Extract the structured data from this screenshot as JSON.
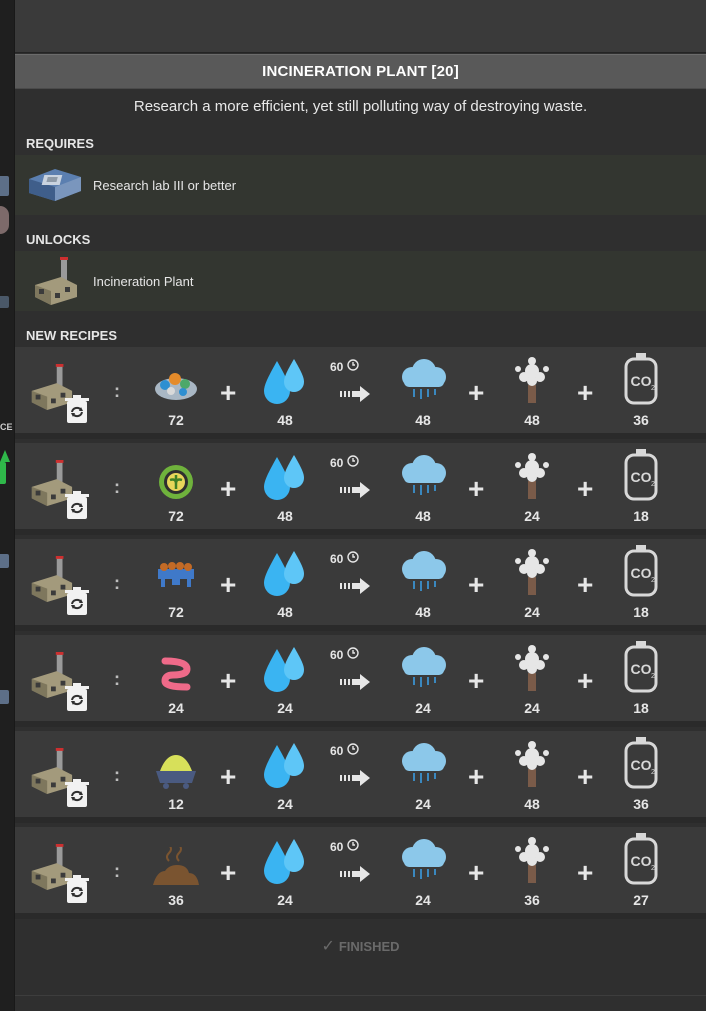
{
  "research": {
    "title": "INCINERATION PLANT [20]",
    "description": "Research a more efficient, yet still polluting way of destroying waste."
  },
  "requires": {
    "label": "REQUIRES",
    "items": [
      {
        "name": "Research lab III or better",
        "icon": "research-lab-icon"
      }
    ]
  },
  "unlocks": {
    "label": "UNLOCKS",
    "items": [
      {
        "name": "Incineration Plant",
        "icon": "incineration-plant-icon"
      }
    ]
  },
  "recipes_label": "NEW RECIPES",
  "recipes": [
    {
      "machine_icon": "incineration-plant-icon",
      "recycle_icon": "recycle-bin-icon",
      "input_icon": "waste-icon",
      "input_qty": "72",
      "water_qty": "48",
      "duration": "60",
      "steam_qty": "48",
      "exhaust_qty": "48",
      "co2_qty": "36"
    },
    {
      "machine_icon": "incineration-plant-icon",
      "recycle_icon": "recycle-bin-icon",
      "input_icon": "recyclables-icon",
      "input_qty": "72",
      "water_qty": "48",
      "duration": "60",
      "steam_qty": "48",
      "exhaust_qty": "24",
      "co2_qty": "18"
    },
    {
      "machine_icon": "incineration-plant-icon",
      "recycle_icon": "recycle-bin-icon",
      "input_icon": "waste-pellets-icon",
      "input_qty": "72",
      "water_qty": "48",
      "duration": "60",
      "steam_qty": "48",
      "exhaust_qty": "24",
      "co2_qty": "18"
    },
    {
      "machine_icon": "incineration-plant-icon",
      "recycle_icon": "recycle-bin-icon",
      "input_icon": "biomass-waste-icon",
      "input_qty": "24",
      "water_qty": "24",
      "duration": "60",
      "steam_qty": "24",
      "exhaust_qty": "24",
      "co2_qty": "18"
    },
    {
      "machine_icon": "incineration-plant-icon",
      "recycle_icon": "recycle-bin-icon",
      "input_icon": "sulfur-cart-icon",
      "input_qty": "12",
      "water_qty": "24",
      "duration": "60",
      "steam_qty": "24",
      "exhaust_qty": "48",
      "co2_qty": "36"
    },
    {
      "machine_icon": "incineration-plant-icon",
      "recycle_icon": "recycle-bin-icon",
      "input_icon": "sludge-icon",
      "input_qty": "36",
      "water_qty": "24",
      "duration": "60",
      "steam_qty": "24",
      "exhaust_qty": "36",
      "co2_qty": "27"
    }
  ],
  "status": {
    "finished_label": "FINISHED",
    "check_glyph": "✓"
  },
  "left_strip": {
    "text": "CE"
  },
  "colors": {
    "water": "#3ab4f2",
    "steam": "#8cc8ea",
    "co2": "#d8d8d8",
    "finished": "#6a6a6a"
  }
}
